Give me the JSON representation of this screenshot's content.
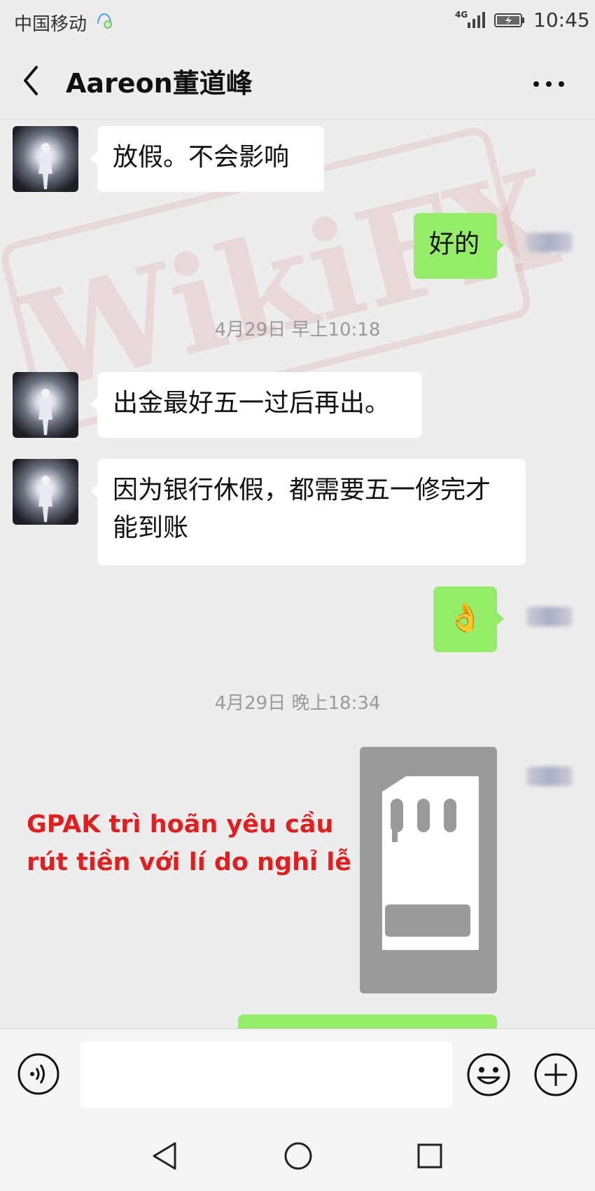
{
  "status_bar": {
    "carrier": "中国移动",
    "network": "4G",
    "time": "10:45"
  },
  "header": {
    "title": "Aareon董道峰"
  },
  "watermark": {
    "text": "WikiFX"
  },
  "messages": [
    {
      "from": "contact",
      "text": "放假。不会影响"
    },
    {
      "from": "me",
      "text": "好的"
    },
    {
      "type": "timestamp",
      "text": "4月29日 早上10:18"
    },
    {
      "from": "contact",
      "text": "出金最好五一过后再出。"
    },
    {
      "from": "contact",
      "text": "因为银行休假，都需要五一修完才能到账"
    },
    {
      "from": "me",
      "text": "👌"
    },
    {
      "type": "timestamp",
      "text": "4月29日 晚上18:34"
    }
  ],
  "annotation": {
    "line1": "GPAK trì hoãn yêu cầu",
    "line2": "rút tiền với lí do nghỉ lễ"
  },
  "colors": {
    "bubble_me": "#95ec69",
    "bubble_contact": "#ffffff",
    "annotation": "#e02020",
    "background": "#ededed"
  },
  "icons": [
    "back-arrow-icon",
    "more-icon",
    "voice-icon",
    "emoji-icon",
    "plus-icon",
    "sd-card-icon",
    "nav-back-icon",
    "nav-home-icon",
    "nav-recent-icon"
  ]
}
